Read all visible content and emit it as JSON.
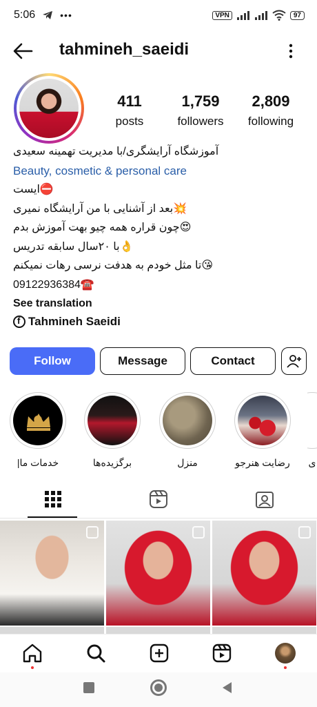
{
  "status_bar": {
    "time": "5:06",
    "vpn": "VPN",
    "battery": "97"
  },
  "header": {
    "username": "tahmineh_saeidi"
  },
  "profile": {
    "stats": [
      {
        "value": "411",
        "label": "posts"
      },
      {
        "value": "1,759",
        "label": "followers"
      },
      {
        "value": "2,809",
        "label": "following"
      }
    ],
    "bio": {
      "line1": "آموزشگاه آرایشگری/با مدیریت تهمینه سعیدی",
      "category": "Beauty, cosmetic & personal care",
      "line2": "⛔ایست",
      "line3": "💥بعد از آشنایی با من  آرایشگاه نمیری",
      "line4": "😍چون قراره همه چیو بهت آموزش بدم",
      "line5": "👌با ۲۰سال سابقه تدریس",
      "line6": "😘تا مثل خودم به هدفت نرسی رهات نمیکنم",
      "phone": "09122936384☎️",
      "see_translation": "See translation"
    },
    "facebook_link": "Tahmineh Saeidi"
  },
  "actions": {
    "follow": "Follow",
    "message": "Message",
    "contact": "Contact"
  },
  "highlights": [
    {
      "label": "خدمات ما|"
    },
    {
      "label": "برگزیده‌ها"
    },
    {
      "label": "منزل"
    },
    {
      "label": "رضایت هنرجو"
    },
    {
      "label": "ی"
    }
  ],
  "tabs": [
    "grid-icon",
    "reels-icon",
    "tagged-icon"
  ],
  "bottom_nav": [
    "home-icon",
    "search-icon",
    "create-icon",
    "reels-icon",
    "profile-avatar"
  ],
  "colors": {
    "follow_button": "#4a6cf7",
    "category_link": "#2a5ea8",
    "notification_dot": "#e33333"
  }
}
